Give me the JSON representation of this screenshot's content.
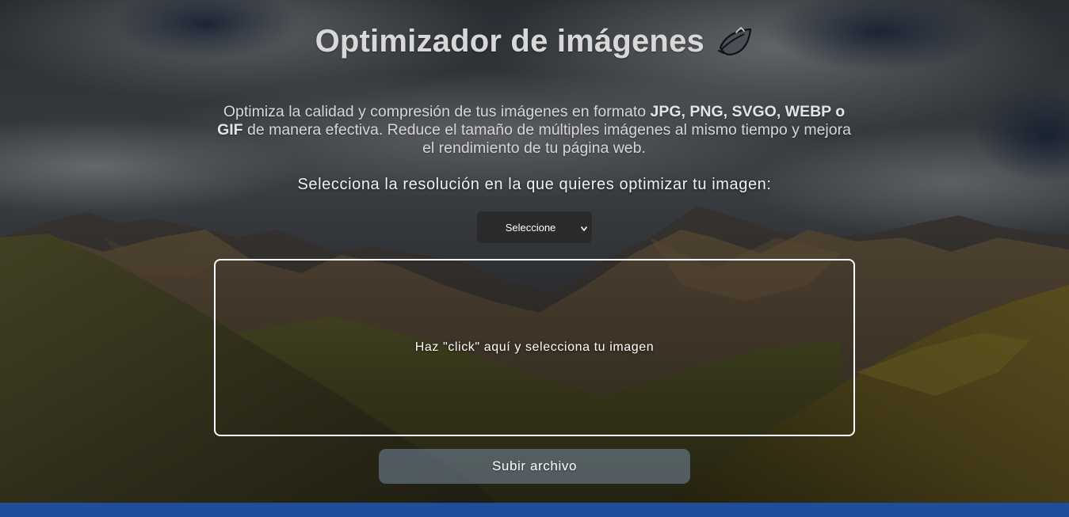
{
  "header": {
    "title": "Optimizador de imágenes",
    "title_icon": "leaf-icon"
  },
  "intro": {
    "text_before": "Optimiza la calidad y compresión de tus imágenes en formato ",
    "formats_primary": "JPG, PNG, SVGO, WEBP o",
    "formats_secondary": "GIF",
    "text_after": " de manera efectiva. Reduce el tamaño de múltiples imágenes al mismo tiempo y mejora el rendimiento de tu página web."
  },
  "resolution": {
    "label": "Selecciona la resolución en la que quieres optimizar tu imagen:",
    "selected": "Seleccione",
    "icon": "chevron-down-icon"
  },
  "dropzone": {
    "text": "Haz \"click\" aquí y selecciona tu imagen"
  },
  "upload": {
    "button_label": "Subir archivo"
  },
  "colors": {
    "title": "#d8d8d8",
    "select_bg": "#2a2a2a",
    "dropzone_border": "#ffffff",
    "upload_button_bg": "rgba(135,160,190,0.45)",
    "footer_bar": "#1f4f9a"
  }
}
